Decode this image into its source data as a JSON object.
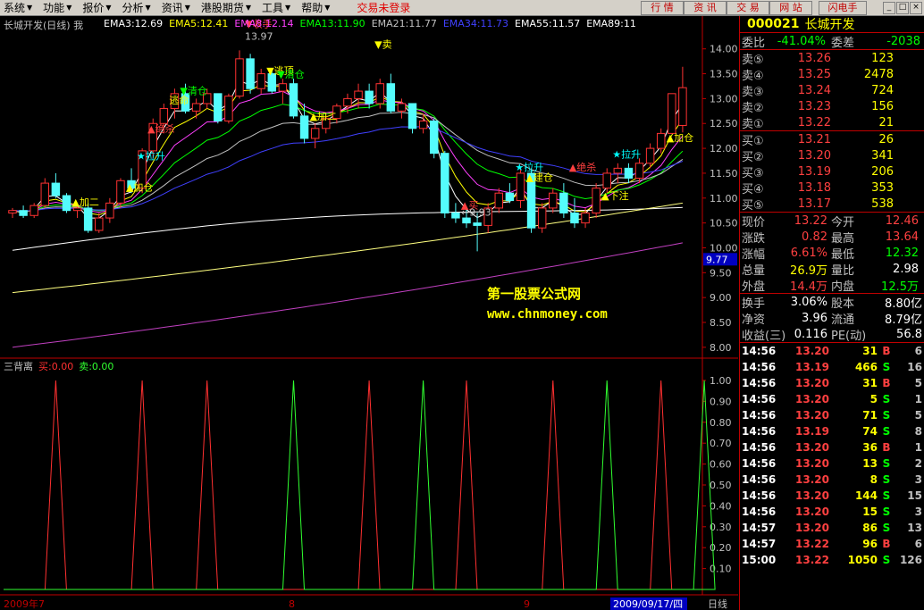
{
  "menu": {
    "items": [
      {
        "label": "系统"
      },
      {
        "label": "功能"
      },
      {
        "label": "报价"
      },
      {
        "label": "分析"
      },
      {
        "label": "资讯"
      },
      {
        "label": "港股期货"
      },
      {
        "label": "工具"
      },
      {
        "label": "帮助"
      }
    ],
    "trade_status": "交易未登录",
    "buttons": [
      "行 情",
      "资 讯",
      "交 易",
      "网 站",
      "闪电手"
    ],
    "window_controls": [
      "_",
      "□",
      "×"
    ]
  },
  "main_chart": {
    "title": "长城开发(日线) 我",
    "ema_labels": [
      {
        "text": "EMA3:12.69",
        "color": "#ffffff"
      },
      {
        "text": "EMA5:12.41",
        "color": "#ffff00"
      },
      {
        "text": "EMA8:12.14",
        "color": "#ff40ff"
      },
      {
        "text": "EMA13:11.90",
        "color": "#00ff00"
      },
      {
        "text": "EMA21:11.77",
        "color": "#c0c0c0"
      },
      {
        "text": "EMA34:11.73",
        "color": "#4040ff"
      },
      {
        "text": "EMA55:11.57",
        "color": "#ffffff"
      },
      {
        "text": "EMA89:11",
        "color": "#ffffff"
      }
    ],
    "y_ticks": [
      "14.00",
      "13.50",
      "13.00",
      "12.50",
      "12.00",
      "11.50",
      "11.00",
      "10.50",
      "10.00",
      "9.50",
      "9.00",
      "8.50",
      "8.00"
    ],
    "current_price_box": "9.77",
    "annotations": [
      {
        "text": "▼收手",
        "color": "#ff4040"
      },
      {
        "text": "13.97",
        "color": "#c0c0c0"
      },
      {
        "text": "▼逃顶",
        "color": "#ffff00"
      },
      {
        "text": "逃命",
        "color": "#ffff00"
      },
      {
        "text": "▼卖",
        "color": "#ffff00"
      },
      {
        "text": "▼清仓",
        "color": "#00ff00"
      },
      {
        "text": "▼清仓",
        "color": "#00ff00"
      },
      {
        "text": "▲加二",
        "color": "#ffff00"
      },
      {
        "text": "▲加二",
        "color": "#ffff00"
      },
      {
        "text": "★拉升",
        "color": "#00ffff"
      },
      {
        "text": "★拉升",
        "color": "#00ffff"
      },
      {
        "text": "★拉升",
        "color": "#00ffff"
      },
      {
        "text": "▲加仓",
        "color": "#ffff00"
      },
      {
        "text": "▲加仓",
        "color": "#ffff00"
      },
      {
        "text": "▲绝杀",
        "color": "#ff4040"
      },
      {
        "text": "▲绝杀",
        "color": "#ff4040"
      },
      {
        "text": "▲买",
        "color": "#ff4040"
      },
      {
        "text": "▲下注",
        "color": "#ffff00"
      },
      {
        "text": "▲建仓",
        "color": "#ffff00"
      },
      {
        "text": "←9.93",
        "color": "#c0c0c0"
      }
    ],
    "watermark_title": "第一股票公式网",
    "watermark_url": "www.chnmoney.com"
  },
  "sub_chart": {
    "title": "三背离",
    "buy_label": "买:0.00",
    "sell_label": "卖:0.00",
    "y_ticks": [
      "1.00",
      "0.90",
      "0.80",
      "0.70",
      "0.60",
      "0.50",
      "0.40",
      "0.30",
      "0.20",
      "0.10"
    ]
  },
  "bottom_bar": {
    "left_date": "2009年7",
    "mid1": "8",
    "mid2": "9",
    "cursor_date": "2009/09/17/四",
    "period": "日线"
  },
  "quote": {
    "code": "000021",
    "name": "长城开发",
    "weibi_label": "委比",
    "weibi_value": "-41.04%",
    "weicha_label": "委差",
    "weicha_value": "-2038",
    "asks": [
      {
        "label": "卖⑤",
        "price": "13.26",
        "vol": "123"
      },
      {
        "label": "卖④",
        "price": "13.25",
        "vol": "2478"
      },
      {
        "label": "卖③",
        "price": "13.24",
        "vol": "724"
      },
      {
        "label": "卖②",
        "price": "13.23",
        "vol": "156"
      },
      {
        "label": "卖①",
        "price": "13.22",
        "vol": "21"
      }
    ],
    "bids": [
      {
        "label": "买①",
        "price": "13.21",
        "vol": "26"
      },
      {
        "label": "买②",
        "price": "13.20",
        "vol": "341"
      },
      {
        "label": "买③",
        "price": "13.19",
        "vol": "206"
      },
      {
        "label": "买④",
        "price": "13.18",
        "vol": "353"
      },
      {
        "label": "买⑤",
        "price": "13.17",
        "vol": "538"
      }
    ],
    "stats": [
      {
        "l1": "现价",
        "v1": "13.22",
        "c1": "#ff4040",
        "l2": "今开",
        "v2": "12.46",
        "c2": "#ff4040"
      },
      {
        "l1": "涨跌",
        "v1": "0.82",
        "c1": "#ff4040",
        "l2": "最高",
        "v2": "13.64",
        "c2": "#ff4040"
      },
      {
        "l1": "涨幅",
        "v1": "6.61%",
        "c1": "#ff4040",
        "l2": "最低",
        "v2": "12.32",
        "c2": "#00ff00"
      },
      {
        "l1": "总量",
        "v1": "26.9万",
        "c1": "#ffff00",
        "l2": "量比",
        "v2": "2.98",
        "c2": "#ffffff"
      },
      {
        "l1": "外盘",
        "v1": "14.4万",
        "c1": "#ff4040",
        "l2": "内盘",
        "v2": "12.5万",
        "c2": "#00ff00"
      }
    ],
    "stats2": [
      {
        "l1": "换手",
        "v1": "3.06%",
        "l2": "股本",
        "v2": "8.80亿"
      },
      {
        "l1": "净资",
        "v1": "3.96",
        "l2": "流通",
        "v2": "8.79亿"
      },
      {
        "l1": "收益(三)",
        "v1": "0.116",
        "l2": "PE(动)",
        "v2": "56.8"
      }
    ],
    "ticks": [
      {
        "time": "14:56",
        "price": "13.20",
        "vol": "31",
        "side": "B",
        "n": "6"
      },
      {
        "time": "14:56",
        "price": "13.19",
        "vol": "466",
        "side": "S",
        "n": "16"
      },
      {
        "time": "14:56",
        "price": "13.20",
        "vol": "31",
        "side": "B",
        "n": "5"
      },
      {
        "time": "14:56",
        "price": "13.20",
        "vol": "5",
        "side": "S",
        "n": "1"
      },
      {
        "time": "14:56",
        "price": "13.20",
        "vol": "71",
        "side": "S",
        "n": "5"
      },
      {
        "time": "14:56",
        "price": "13.19",
        "vol": "74",
        "side": "S",
        "n": "8"
      },
      {
        "time": "14:56",
        "price": "13.20",
        "vol": "36",
        "side": "B",
        "n": "1"
      },
      {
        "time": "14:56",
        "price": "13.20",
        "vol": "13",
        "side": "S",
        "n": "2"
      },
      {
        "time": "14:56",
        "price": "13.20",
        "vol": "8",
        "side": "S",
        "n": "3"
      },
      {
        "time": "14:56",
        "price": "13.20",
        "vol": "144",
        "side": "S",
        "n": "15"
      },
      {
        "time": "14:56",
        "price": "13.20",
        "vol": "15",
        "side": "S",
        "n": "3"
      },
      {
        "time": "14:57",
        "price": "13.20",
        "vol": "86",
        "side": "S",
        "n": "13"
      },
      {
        "time": "14:57",
        "price": "13.22",
        "vol": "96",
        "side": "B",
        "n": "6"
      },
      {
        "time": "15:00",
        "price": "13.22",
        "vol": "1050",
        "side": "S",
        "n": "126"
      }
    ]
  },
  "chart_data": [
    {
      "type": "candlestick",
      "title": "长城开发(日线)",
      "ylim": [
        7.8,
        14.3
      ],
      "candles": [
        [
          10.7,
          10.8,
          10.6,
          10.75
        ],
        [
          10.75,
          10.85,
          10.6,
          10.65
        ],
        [
          10.65,
          10.9,
          10.6,
          10.85
        ],
        [
          10.85,
          11.4,
          10.8,
          11.3
        ],
        [
          11.3,
          11.5,
          11.0,
          11.05
        ],
        [
          11.05,
          11.1,
          10.7,
          10.75
        ],
        [
          10.75,
          10.9,
          10.6,
          10.8
        ],
        [
          10.8,
          10.9,
          10.3,
          10.35
        ],
        [
          10.35,
          10.7,
          10.3,
          10.6
        ],
        [
          10.6,
          11.0,
          10.5,
          10.9
        ],
        [
          10.9,
          11.4,
          10.8,
          11.35
        ],
        [
          11.35,
          11.6,
          11.1,
          11.2
        ],
        [
          11.2,
          12.0,
          11.1,
          11.95
        ],
        [
          11.95,
          12.6,
          11.8,
          12.5
        ],
        [
          12.5,
          12.9,
          12.3,
          12.8
        ],
        [
          12.8,
          13.2,
          12.6,
          13.1
        ],
        [
          13.1,
          13.3,
          12.7,
          12.75
        ],
        [
          12.75,
          13.0,
          12.6,
          12.9
        ],
        [
          12.9,
          13.2,
          12.8,
          13.1
        ],
        [
          13.1,
          13.0,
          12.5,
          12.55
        ],
        [
          12.55,
          13.1,
          12.5,
          13.05
        ],
        [
          13.05,
          13.97,
          13.0,
          13.8
        ],
        [
          13.8,
          13.9,
          13.1,
          13.2
        ],
        [
          13.2,
          13.6,
          13.1,
          13.5
        ],
        [
          13.5,
          13.6,
          13.1,
          13.15
        ],
        [
          13.15,
          13.4,
          12.9,
          13.3
        ],
        [
          13.3,
          13.4,
          12.6,
          12.65
        ],
        [
          12.65,
          12.9,
          12.1,
          12.2
        ],
        [
          12.2,
          12.5,
          12.0,
          12.4
        ],
        [
          12.4,
          12.7,
          12.3,
          12.6
        ],
        [
          12.6,
          12.9,
          12.5,
          12.85
        ],
        [
          12.85,
          13.1,
          12.7,
          13.0
        ],
        [
          13.0,
          13.3,
          12.8,
          13.15
        ],
        [
          13.15,
          13.3,
          12.8,
          12.9
        ],
        [
          12.9,
          13.4,
          12.8,
          13.3
        ],
        [
          13.3,
          13.5,
          12.7,
          12.75
        ],
        [
          12.75,
          13.0,
          12.6,
          12.9
        ],
        [
          12.9,
          12.8,
          12.3,
          12.4
        ],
        [
          12.4,
          12.7,
          12.3,
          12.55
        ],
        [
          12.55,
          12.6,
          11.8,
          11.9
        ],
        [
          11.9,
          11.95,
          10.6,
          10.7
        ],
        [
          10.7,
          10.9,
          10.5,
          10.6
        ],
        [
          10.6,
          10.8,
          10.4,
          10.5
        ],
        [
          10.5,
          10.7,
          9.93,
          10.45
        ],
        [
          10.45,
          10.9,
          10.3,
          10.8
        ],
        [
          10.8,
          11.2,
          10.7,
          11.1
        ],
        [
          11.1,
          11.3,
          10.9,
          10.95
        ],
        [
          10.95,
          11.6,
          10.8,
          11.5
        ],
        [
          11.5,
          11.6,
          10.3,
          10.4
        ],
        [
          10.4,
          10.9,
          10.3,
          10.8
        ],
        [
          10.8,
          11.2,
          10.7,
          11.1
        ],
        [
          11.1,
          11.3,
          10.6,
          10.7
        ],
        [
          10.7,
          11.0,
          10.4,
          10.5
        ],
        [
          10.5,
          10.8,
          10.4,
          10.7
        ],
        [
          10.7,
          11.3,
          10.6,
          11.2
        ],
        [
          11.2,
          11.6,
          11.1,
          11.5
        ],
        [
          11.5,
          11.7,
          11.3,
          11.6
        ],
        [
          11.6,
          11.7,
          11.3,
          11.4
        ],
        [
          11.4,
          11.8,
          11.3,
          11.7
        ],
        [
          11.7,
          12.1,
          11.6,
          12.0
        ],
        [
          12.0,
          12.4,
          11.9,
          12.3
        ],
        [
          12.3,
          13.0,
          12.3,
          13.1
        ],
        [
          12.46,
          13.64,
          12.32,
          13.22
        ]
      ]
    },
    {
      "type": "line",
      "title": "三背离",
      "ylim": [
        0,
        1
      ],
      "series": [
        {
          "name": "买",
          "color": "#ff3030",
          "peaks": [
            4,
            12,
            18,
            33,
            42,
            50,
            60
          ]
        },
        {
          "name": "卖",
          "color": "#30ff30",
          "peaks": [
            26,
            38,
            55,
            64
          ]
        }
      ]
    }
  ]
}
